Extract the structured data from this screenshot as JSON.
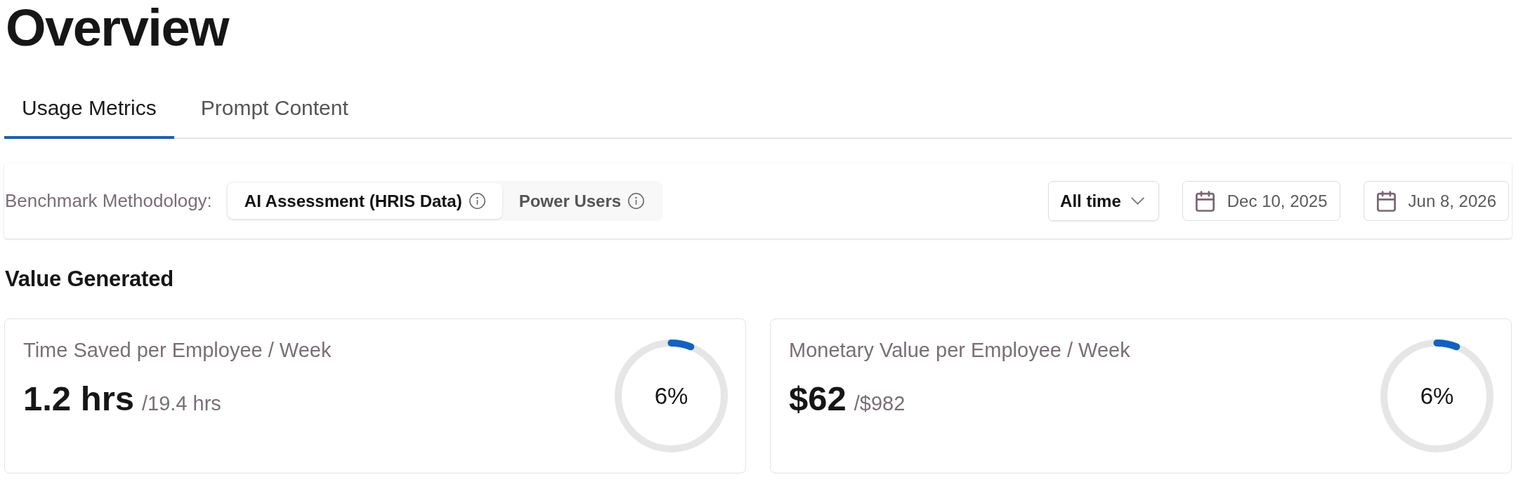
{
  "page": {
    "title": "Overview"
  },
  "tabs": [
    {
      "label": "Usage Metrics",
      "selected": true
    },
    {
      "label": "Prompt Content",
      "selected": false
    }
  ],
  "filters": {
    "benchmark_label": "Benchmark Methodology:",
    "benchmark_options": [
      {
        "label": "AI Assessment (HRIS Data)",
        "selected": true
      },
      {
        "label": "Power Users",
        "selected": false
      }
    ],
    "range": {
      "value": "All time"
    },
    "dates": [
      {
        "value": "Dec 10, 2025"
      },
      {
        "value": "Jun 8, 2026"
      }
    ]
  },
  "value_generated": {
    "heading": "Value Generated",
    "cards": [
      {
        "title": "Time Saved per Employee / Week",
        "value": "1.2 hrs",
        "total": "/19.4 hrs",
        "percent": "6%",
        "level": 0.06
      },
      {
        "title": "Monetary Value per Employee / Week",
        "value": "$62",
        "total": "/$982",
        "percent": "6%",
        "level": 0.06
      }
    ]
  }
}
